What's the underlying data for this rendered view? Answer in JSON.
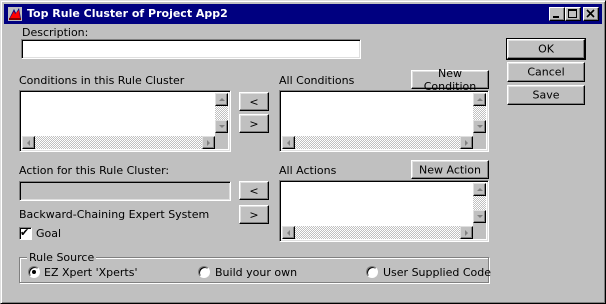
{
  "window": {
    "title": "Top Rule Cluster of Project App2",
    "controls": {
      "minimize": "minimize",
      "maximize": "maximize",
      "close": "close"
    }
  },
  "description": {
    "label": "Description:",
    "value": ""
  },
  "conditions": {
    "label": "Conditions in this Rule Cluster",
    "all_label": "All Conditions",
    "new_button": "New Condition",
    "add_arrow": "<",
    "remove_arrow": ">",
    "items": [],
    "all_items": []
  },
  "actions": {
    "label": "Action for this Rule Cluster:",
    "value": "",
    "all_label": "All Actions",
    "new_button": "New Action",
    "add_arrow": "<",
    "remove_arrow": ">",
    "all_items": []
  },
  "backward_chaining": {
    "label": "Backward-Chaining Expert System"
  },
  "goal": {
    "label": "Goal",
    "checked": true,
    "check_glyph": "✔"
  },
  "buttons": {
    "ok": "OK",
    "cancel": "Cancel",
    "save": "Save"
  },
  "rule_source": {
    "title": "Rule Source",
    "options": [
      {
        "label": "EZ Xpert 'Xperts'",
        "selected": true
      },
      {
        "label": "Build your own",
        "selected": false
      },
      {
        "label": "User Supplied Code",
        "selected": false
      }
    ]
  }
}
